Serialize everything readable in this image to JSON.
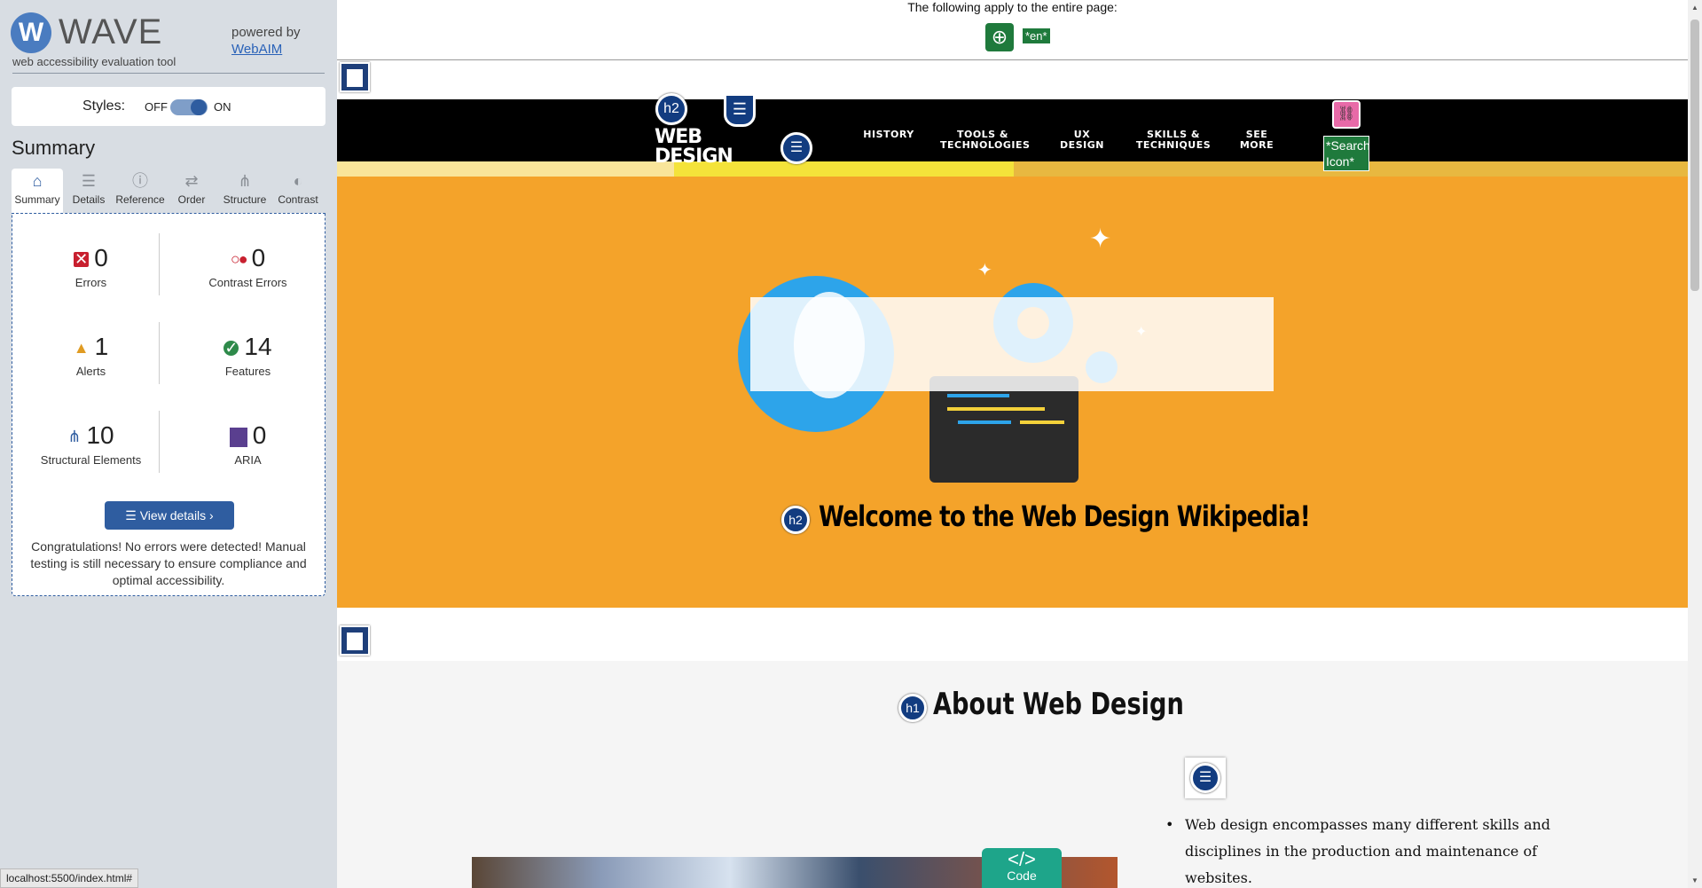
{
  "wave": {
    "logo_letter": "W",
    "title": "WAVE",
    "tagline": "web accessibility evaluation tool",
    "powered_by": "powered by",
    "webaim_link": "WebAIM",
    "styles_label": "Styles:",
    "toggle_off": "OFF",
    "toggle_on": "ON",
    "styles_enabled": true,
    "summary_heading": "Summary",
    "tabs": [
      {
        "label": "Summary",
        "icon": "home-icon",
        "glyph": "⌂"
      },
      {
        "label": "Details",
        "icon": "list-icon",
        "glyph": "☰"
      },
      {
        "label": "Reference",
        "icon": "info-icon",
        "glyph": "ⓘ"
      },
      {
        "label": "Order",
        "icon": "order-icon",
        "glyph": "⇄"
      },
      {
        "label": "Structure",
        "icon": "structure-icon",
        "glyph": "⋔"
      },
      {
        "label": "Contrast",
        "icon": "contrast-icon",
        "glyph": "◐"
      }
    ],
    "stats": {
      "errors": {
        "value": "0",
        "label": "Errors"
      },
      "contrast_errors": {
        "value": "0",
        "label": "Contrast Errors"
      },
      "alerts": {
        "value": "1",
        "label": "Alerts"
      },
      "features": {
        "value": "14",
        "label": "Features"
      },
      "structural": {
        "value": "10",
        "label": "Structural Elements"
      },
      "aria": {
        "value": "0",
        "label": "ARIA"
      }
    },
    "view_details": "View details ›",
    "congrats": "Congratulations! No errors were detected! Manual testing is still necessary to ensure compliance and optimal accessibility."
  },
  "statusbar": {
    "url": "localhost:5500/index.html#"
  },
  "page": {
    "top_notice": "The following apply to the entire page:",
    "lang_tag": "*en*",
    "brand": [
      "WEB",
      "DESIGN"
    ],
    "h2_badge": "h2",
    "h1_badge": "h1",
    "nav": [
      {
        "line1": "HISTORY",
        "line2": ""
      },
      {
        "line1": "TOOLS &",
        "line2": "TECHNOLOGIES"
      },
      {
        "line1": "UX",
        "line2": "DESIGN"
      },
      {
        "line1": "SKILLS &",
        "line2": "TECHNIQUES"
      },
      {
        "line1": "SEE",
        "line2": "MORE"
      }
    ],
    "search_tag": "*Search Icon*",
    "hero_title": "Welcome to the Web Design Wikipedia!",
    "about_title": "About Web Design",
    "about_text": "Web design encompasses many different skills and disciplines in the production and maintenance of websites.",
    "code_badge_tag": "</>",
    "code_badge_label": "Code"
  },
  "colors": {
    "wave_blue": "#2f5da0",
    "hero_orange": "#f4a32a",
    "nav_black": "#000000",
    "stripe_light": "#f9e59a",
    "stripe_bright": "#f4e33a",
    "stripe_gold": "#e8b840",
    "feature_green": "#1f7a3c"
  }
}
